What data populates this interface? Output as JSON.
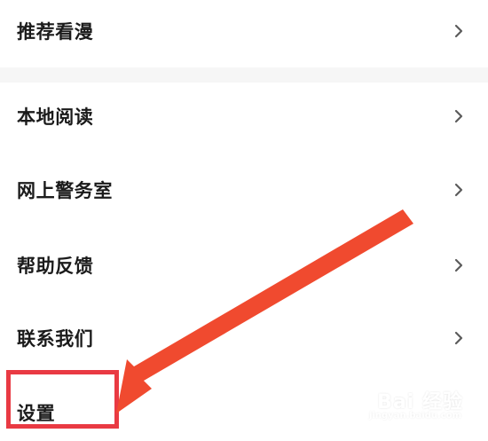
{
  "menu": {
    "items": [
      {
        "label": "推荐看漫"
      },
      {
        "label": "本地阅读"
      },
      {
        "label": "网上警务室"
      },
      {
        "label": "帮助反馈"
      },
      {
        "label": "联系我们"
      },
      {
        "label": "设置"
      }
    ]
  },
  "watermark": {
    "logo_text": "Bai 经验",
    "sub_text": "jingyan.baidu.com"
  },
  "colors": {
    "text": "#1b1b1b",
    "chevron": "#5c5c5c",
    "divider": "#f6f6f6",
    "highlight": "#e93a43",
    "arrow": "#f04a2f"
  },
  "icons": {
    "chevron": "chevron-right-icon",
    "arrow": "pointer-arrow-icon",
    "watermark": "baidu-paw-icon"
  }
}
